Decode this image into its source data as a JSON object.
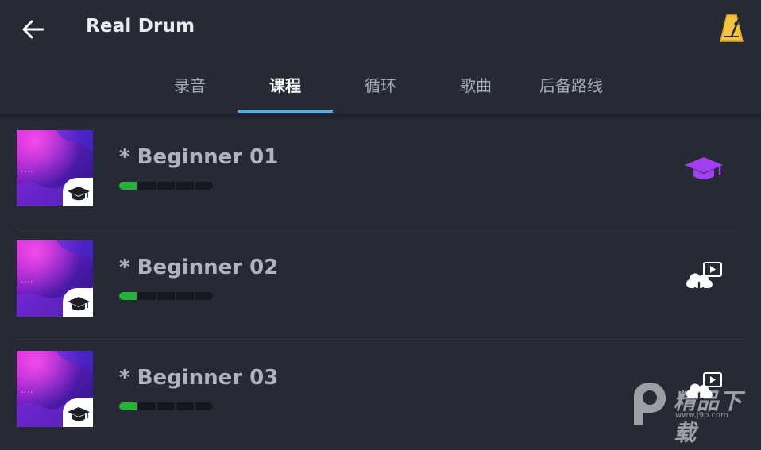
{
  "header": {
    "title": "Real Drum",
    "back_icon": "arrow-left-icon",
    "metronome_icon": "metronome-icon"
  },
  "tabs": [
    {
      "label": "录音",
      "active": false
    },
    {
      "label": "课程",
      "active": true
    },
    {
      "label": "循环",
      "active": false
    },
    {
      "label": "歌曲",
      "active": false
    },
    {
      "label": "后备路线",
      "active": false
    }
  ],
  "colors": {
    "background": "#262a35",
    "tab_indicator": "#4fb1e8",
    "progress_done": "#27b03a",
    "lesson_icon": "#a23ff0"
  },
  "lessons": [
    {
      "title": "* Beginner 01",
      "progress_segments": 5,
      "progress_done": 1,
      "action_icon": "graduation-cap-icon"
    },
    {
      "title": "* Beginner 02",
      "progress_segments": 5,
      "progress_done": 1,
      "action_icon": "cloud-download-video-icon"
    },
    {
      "title": "* Beginner 03",
      "progress_segments": 5,
      "progress_done": 1,
      "action_icon": "cloud-download-video-icon"
    }
  ],
  "watermark": {
    "text": "精品下载",
    "url": "www.j9p.com"
  }
}
